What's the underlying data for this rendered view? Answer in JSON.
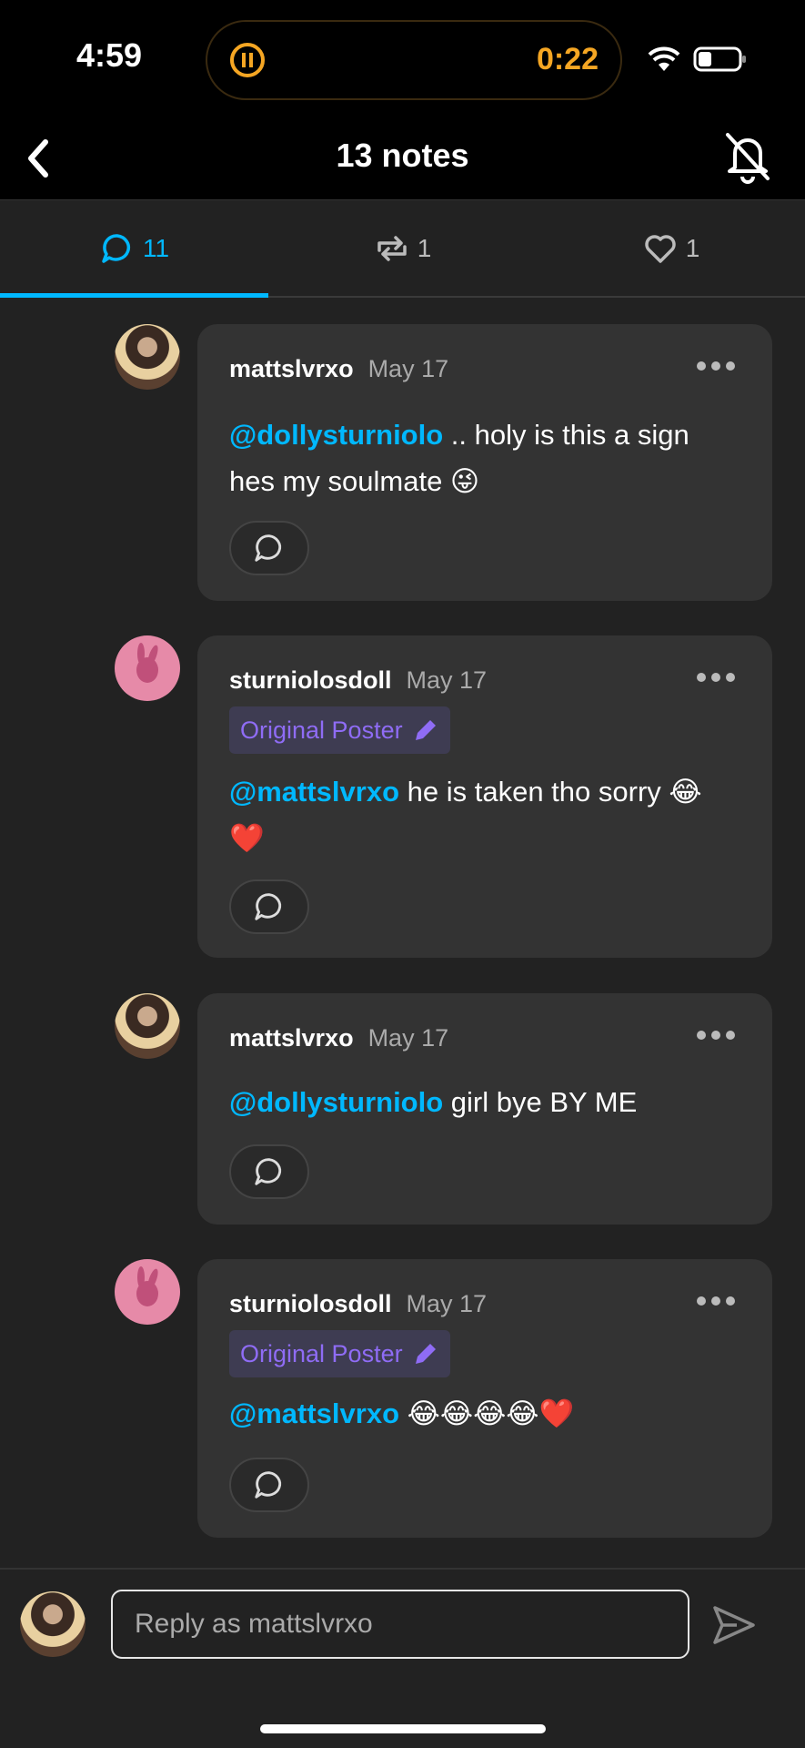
{
  "status_bar": {
    "time": "4:59",
    "timer": "0:22"
  },
  "header": {
    "title": "13 notes"
  },
  "tabs": [
    {
      "label": "11",
      "icon": "comment-icon",
      "active": true
    },
    {
      "label": "1",
      "icon": "reblog-icon",
      "active": false
    },
    {
      "label": "1",
      "icon": "heart-icon",
      "active": false
    }
  ],
  "notes": [
    {
      "username": "mattslvrxo",
      "date": "May 17",
      "mention": "@dollysturniolo",
      "text": ".. holy is this a sign hes my soulmate 😜",
      "original_poster": false
    },
    {
      "username": "sturniolosdoll",
      "date": "May 17",
      "badge": "Original Poster",
      "mention": "@mattslvrxo",
      "text": "he is taken tho sorry 😂❤️",
      "original_poster": true
    },
    {
      "username": "mattslvrxo",
      "date": "May 17",
      "mention": "@dollysturniolo",
      "text": "girl bye BY ME",
      "original_poster": false
    },
    {
      "username": "sturniolosdoll",
      "date": "May 17",
      "badge": "Original Poster",
      "mention": "@mattslvrxo",
      "text": "😂😂😂😂❤️",
      "original_poster": true
    }
  ],
  "reply": {
    "placeholder": "Reply as mattslvrxo"
  },
  "colors": {
    "accent": "#00b8ff",
    "op_badge": "#8f6cf5",
    "timer": "#f5a623",
    "card": "#333333",
    "background": "#222222"
  }
}
